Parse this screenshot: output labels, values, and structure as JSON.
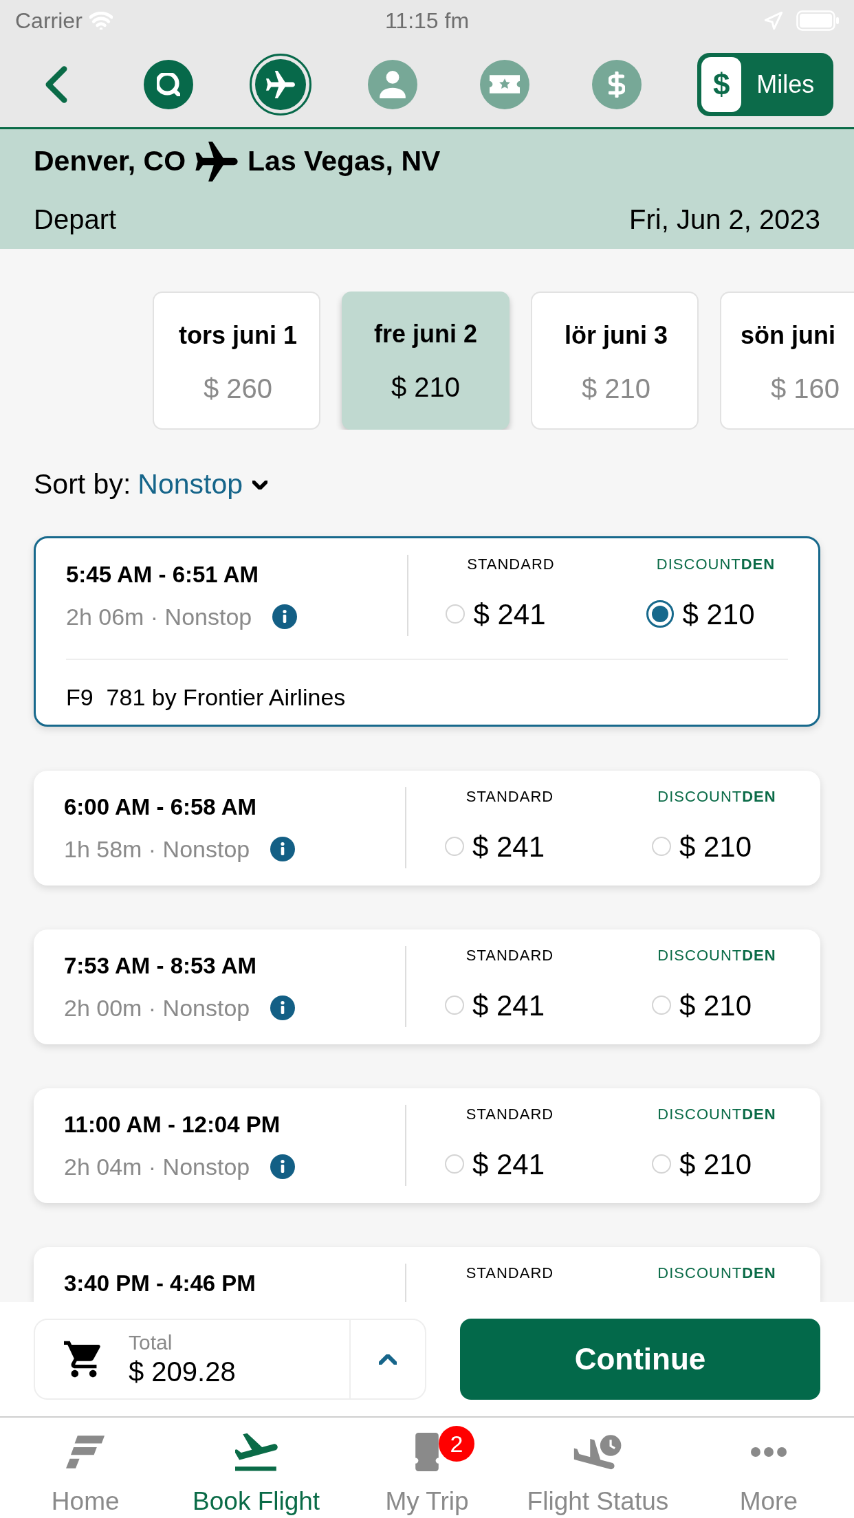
{
  "status_bar": {
    "carrier": "Carrier",
    "time": "11:15 fm"
  },
  "nav": {
    "steps": [
      {
        "kind": "search",
        "reached": true,
        "selected": false
      },
      {
        "kind": "plane",
        "reached": true,
        "selected": true
      },
      {
        "kind": "person",
        "reached": false,
        "selected": false
      },
      {
        "kind": "ticket",
        "reached": false,
        "selected": false
      },
      {
        "kind": "dollar",
        "reached": false,
        "selected": false
      }
    ],
    "currency_toggle": [
      {
        "label": "$",
        "selected": true
      },
      {
        "label": "Miles",
        "selected": false
      }
    ]
  },
  "route": {
    "origin": "Denver, CO",
    "destination": "Las Vegas, NV",
    "direction": "Depart",
    "date": "Fri, Jun 2, 2023"
  },
  "dates": [
    {
      "label": "tors juni 1",
      "price": "$ 260",
      "selected": false
    },
    {
      "label": "fre juni 2",
      "price": "$ 210",
      "selected": true
    },
    {
      "label": "lör juni 3",
      "price": "$ 210",
      "selected": false
    },
    {
      "label": "sön juni",
      "price": "$ 160",
      "selected": false
    }
  ],
  "sort": {
    "label": "Sort by:",
    "value": "Nonstop"
  },
  "flights": [
    {
      "times": "5:45 AM - 6:51 AM",
      "duration": "2h 06m · Nonstop",
      "selected": true,
      "fares": [
        {
          "kind": "standard",
          "label": "STANDARD",
          "price": "$ 241",
          "selected": false
        },
        {
          "kind": "discount",
          "label": "DISCOUNT**DEN**",
          "price": "$ 210",
          "selected": true
        }
      ],
      "flight_number": "F9  781 by Frontier Airlines"
    },
    {
      "times": "6:00 AM - 6:58 AM",
      "duration": "1h 58m · Nonstop",
      "selected": false,
      "fares": [
        {
          "kind": "standard",
          "label": "STANDARD",
          "price": "$ 241",
          "selected": false
        },
        {
          "kind": "discount",
          "label": "DISCOUNT**DEN**",
          "price": "$ 210",
          "selected": false
        }
      ]
    },
    {
      "times": "7:53 AM - 8:53 AM",
      "duration": "2h 00m · Nonstop",
      "selected": false,
      "fares": [
        {
          "kind": "standard",
          "label": "STANDARD",
          "price": "$ 241",
          "selected": false
        },
        {
          "kind": "discount",
          "label": "DISCOUNT**DEN**",
          "price": "$ 210",
          "selected": false
        }
      ]
    },
    {
      "times": "11:00 AM - 12:04 PM",
      "duration": "2h 04m · Nonstop",
      "selected": false,
      "fares": [
        {
          "kind": "standard",
          "label": "STANDARD",
          "price": "$ 241",
          "selected": false
        },
        {
          "kind": "discount",
          "label": "DISCOUNT**DEN**",
          "price": "$ 210",
          "selected": false
        }
      ]
    },
    {
      "times": "3:40 PM - 4:46 PM",
      "selected": false,
      "fares": [
        {
          "kind": "standard",
          "label": "STANDARD"
        },
        {
          "kind": "discount",
          "label": "DISCOUNT**DEN**"
        }
      ]
    }
  ],
  "cart": {
    "label": "Total",
    "amount": "$ 209.28",
    "expanded": false
  },
  "continue_button": {
    "label": "Continue"
  },
  "tab_bar": [
    {
      "kind": "home",
      "label": "Home",
      "selected": false
    },
    {
      "kind": "book",
      "label": "Book Flight",
      "selected": true
    },
    {
      "kind": "trip",
      "label": "My Trip",
      "selected": false,
      "badge": "2"
    },
    {
      "kind": "status",
      "label": "Flight Status",
      "selected": false
    },
    {
      "kind": "more",
      "label": "More",
      "selected": false
    }
  ]
}
